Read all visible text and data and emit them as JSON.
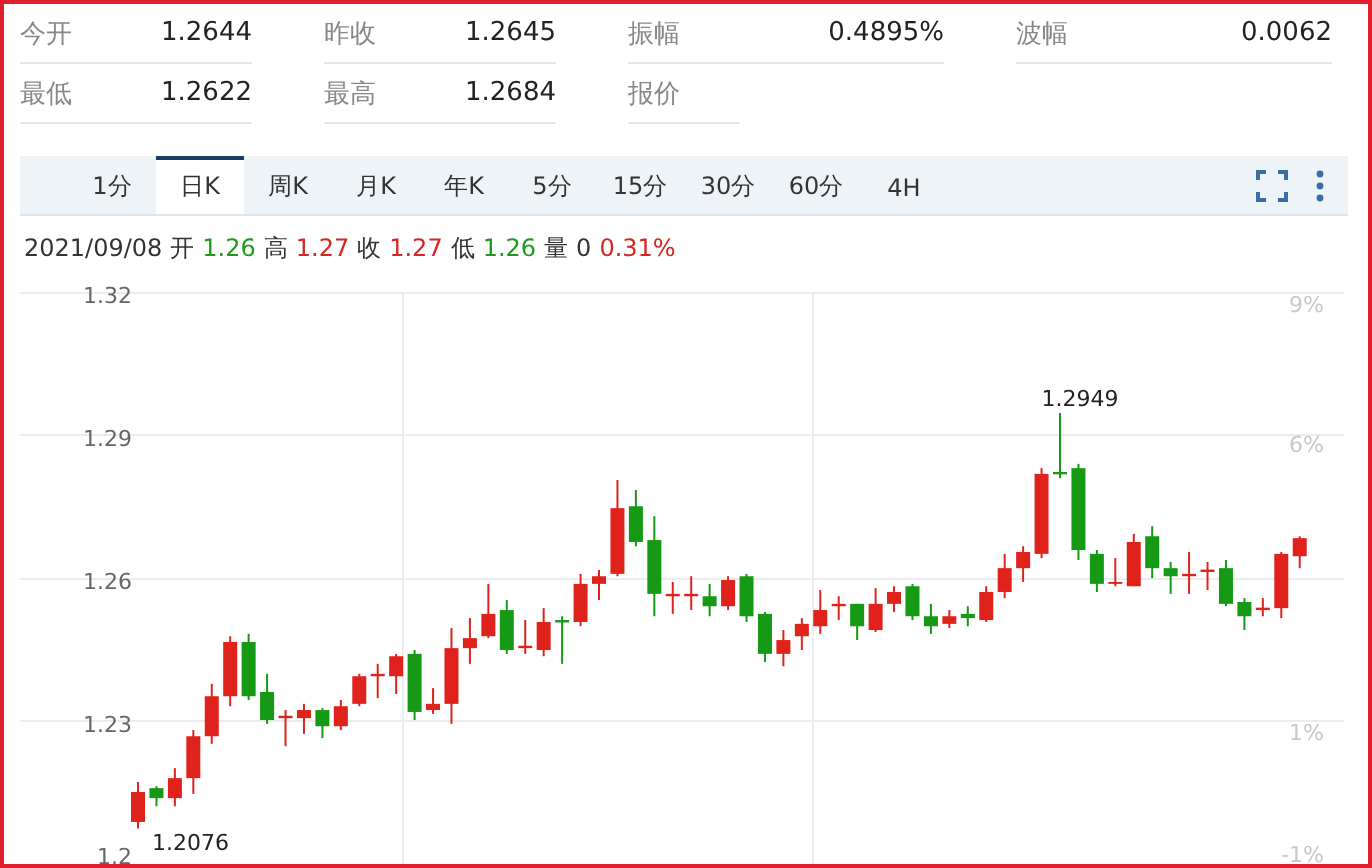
{
  "quote_fields": [
    {
      "label": "今开",
      "value": "1.2644"
    },
    {
      "label": "昨收",
      "value": "1.2645"
    },
    {
      "label": "振幅",
      "value": "0.4895%"
    },
    {
      "label": "波幅",
      "value": "0.0062"
    },
    {
      "label": "最低",
      "value": "1.2622"
    },
    {
      "label": "最高",
      "value": "1.2684"
    },
    {
      "label": "报价"
    }
  ],
  "tabs": [
    {
      "label": "1分",
      "selected": false
    },
    {
      "label": "日K",
      "selected": true
    },
    {
      "label": "周K",
      "selected": false
    },
    {
      "label": "月K",
      "selected": false
    },
    {
      "label": "年K",
      "selected": false
    },
    {
      "label": "5分",
      "selected": false
    },
    {
      "label": "15分",
      "selected": false
    },
    {
      "label": "30分",
      "selected": false
    },
    {
      "label": "60分",
      "selected": false
    },
    {
      "label": "4H",
      "selected": false
    }
  ],
  "quote_line": {
    "date": "2021/09/08",
    "items": [
      {
        "label": "开",
        "value": "1.26",
        "color": "#1f9a1f"
      },
      {
        "label": "高",
        "value": "1.27",
        "color": "#d7261e"
      },
      {
        "label": "收",
        "value": "1.27",
        "color": "#d7261e"
      },
      {
        "label": "低",
        "value": "1.26",
        "color": "#1f9a1f"
      },
      {
        "label": "量",
        "value": "0",
        "color": "#333333"
      }
    ],
    "change": "0.31%"
  },
  "chart": {
    "percent_ticks": [
      "9%",
      "6%",
      "1%",
      "-1%"
    ],
    "high_label": "1.2949",
    "low_label": "1.2076",
    "chart_data": {
      "type": "candlestick",
      "grid": true,
      "ylim": [
        1.2,
        1.32
      ],
      "yticks": [
        {
          "value": 1.32,
          "label": "1.32"
        },
        {
          "value": 1.29,
          "label": "1.29"
        },
        {
          "value": 1.26,
          "label": "1.26"
        },
        {
          "value": 1.23,
          "label": "1.23"
        },
        {
          "value": 1.2,
          "label": "1.2"
        }
      ],
      "ohlc": [
        [
          1.209,
          1.2174,
          1.2076,
          1.2153
        ],
        [
          1.2161,
          1.2165,
          1.2123,
          1.214
        ],
        [
          1.214,
          1.2203,
          1.2123,
          1.2182
        ],
        [
          1.2182,
          1.2283,
          1.2149,
          1.227
        ],
        [
          1.227,
          1.238,
          1.2254,
          1.2354
        ],
        [
          1.2354,
          1.248,
          1.2333,
          1.2468
        ],
        [
          1.2468,
          1.2485,
          1.2346,
          1.2354
        ],
        [
          1.2363,
          1.2401,
          1.2296,
          1.2304
        ],
        [
          1.2308,
          1.2325,
          1.2249,
          1.2313
        ],
        [
          1.2308,
          1.2338,
          1.2275,
          1.2325
        ],
        [
          1.2325,
          1.2329,
          1.2266,
          1.2291
        ],
        [
          1.2291,
          1.2346,
          1.2283,
          1.2333
        ],
        [
          1.2338,
          1.2401,
          1.2333,
          1.2396
        ],
        [
          1.2396,
          1.2422,
          1.235,
          1.2401
        ],
        [
          1.2396,
          1.2443,
          1.2359,
          1.2438
        ],
        [
          1.2443,
          1.2451,
          1.2304,
          1.2321
        ],
        [
          1.2325,
          1.2371,
          1.2317,
          1.2338
        ],
        [
          1.2338,
          1.2497,
          1.2296,
          1.2455
        ],
        [
          1.2455,
          1.2518,
          1.2422,
          1.2476
        ],
        [
          1.248,
          1.259,
          1.2476,
          1.2527
        ],
        [
          1.2535,
          1.2556,
          1.2443,
          1.2451
        ],
        [
          1.2455,
          1.2514,
          1.2443,
          1.246
        ],
        [
          1.2451,
          1.2539,
          1.2438,
          1.251
        ],
        [
          1.2514,
          1.2522,
          1.2422,
          1.2509
        ],
        [
          1.251,
          1.2611,
          1.2501,
          1.259
        ],
        [
          1.259,
          1.2619,
          1.2556,
          1.2606
        ],
        [
          1.2611,
          1.2808,
          1.2606,
          1.2749
        ],
        [
          1.2753,
          1.2787,
          1.2669,
          1.2678
        ],
        [
          1.2682,
          1.2732,
          1.2522,
          1.2569
        ],
        [
          1.2564,
          1.2594,
          1.2527,
          1.2569
        ],
        [
          1.2564,
          1.2606,
          1.2535,
          1.2569
        ],
        [
          1.2564,
          1.259,
          1.2522,
          1.2543
        ],
        [
          1.2543,
          1.2606,
          1.2535,
          1.2598
        ],
        [
          1.2606,
          1.2611,
          1.251,
          1.2522
        ],
        [
          1.2527,
          1.2531,
          1.2426,
          1.2443
        ],
        [
          1.2443,
          1.2493,
          1.2417,
          1.2472
        ],
        [
          1.248,
          1.2518,
          1.2451,
          1.2506
        ],
        [
          1.2501,
          1.2577,
          1.2485,
          1.2535
        ],
        [
          1.2543,
          1.2564,
          1.2514,
          1.2548
        ],
        [
          1.2548,
          1.2548,
          1.2472,
          1.2501
        ],
        [
          1.2493,
          1.2581,
          1.2489,
          1.2548
        ],
        [
          1.2548,
          1.2585,
          1.2531,
          1.2573
        ],
        [
          1.2585,
          1.259,
          1.2514,
          1.2522
        ],
        [
          1.2522,
          1.2548,
          1.2485,
          1.2501
        ],
        [
          1.2506,
          1.2535,
          1.2497,
          1.2522
        ],
        [
          1.2527,
          1.2543,
          1.2501,
          1.2518
        ],
        [
          1.2514,
          1.2585,
          1.251,
          1.2573
        ],
        [
          1.2573,
          1.2653,
          1.256,
          1.2623
        ],
        [
          1.2623,
          1.2669,
          1.2594,
          1.2657
        ],
        [
          1.2653,
          1.2833,
          1.2644,
          1.2821
        ],
        [
          1.2825,
          1.2949,
          1.2812,
          1.282
        ],
        [
          1.2833,
          1.2842,
          1.264,
          1.2661
        ],
        [
          1.2653,
          1.2661,
          1.2573,
          1.259
        ],
        [
          1.259,
          1.2644,
          1.2585,
          1.2594
        ],
        [
          1.2585,
          1.2695,
          1.2585,
          1.2678
        ],
        [
          1.269,
          1.2711,
          1.2602,
          1.2623
        ],
        [
          1.2623,
          1.2636,
          1.2569,
          1.2606
        ],
        [
          1.2606,
          1.2657,
          1.2569,
          1.2611
        ],
        [
          1.2615,
          1.2636,
          1.2577,
          1.262
        ],
        [
          1.2623,
          1.264,
          1.2543,
          1.2548
        ],
        [
          1.2552,
          1.256,
          1.2493,
          1.2522
        ],
        [
          1.2535,
          1.256,
          1.2522,
          1.254
        ],
        [
          1.2539,
          1.2657,
          1.2518,
          1.2653
        ],
        [
          1.2648,
          1.269,
          1.2623,
          1.2686
        ]
      ]
    }
  }
}
